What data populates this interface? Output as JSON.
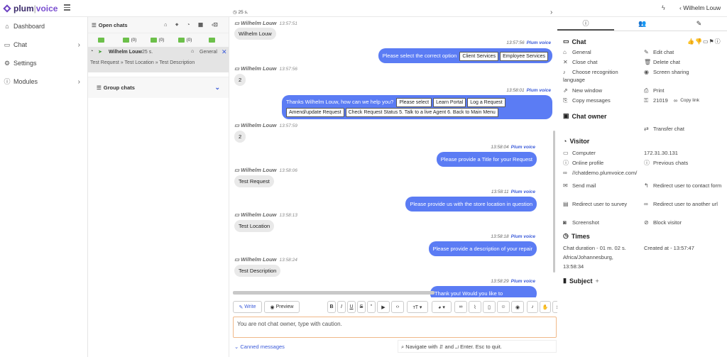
{
  "brand": {
    "name_left": "plum",
    "name_right": "voice"
  },
  "topbar": {
    "counter": "25 s.",
    "user": "Wilhelm Louw"
  },
  "sidebar": {
    "items": [
      {
        "label": "Dashboard",
        "icon": "home-icon"
      },
      {
        "label": "Chat",
        "icon": "chat-icon"
      },
      {
        "label": "Settings",
        "icon": "settings-icon"
      },
      {
        "label": "Modules",
        "icon": "info-icon"
      }
    ]
  },
  "chats": {
    "header": "Open chats",
    "filters": [
      "",
      "(0)",
      "(0)",
      "(0)",
      ""
    ],
    "active": {
      "name": "Wilhelm Louw",
      "time": "25 s.",
      "dept": "General",
      "path": "Test Request » Test Location » Test Description"
    },
    "group_header": "Group chats"
  },
  "conversation": {
    "visitor_name": "Wilhelm Louw",
    "operator_name": "Plum voice",
    "messages": [
      {
        "from": "visitor",
        "time": "13:57:51",
        "text": "Wilhelm Louw"
      },
      {
        "from": "operator",
        "time": "13:57:56",
        "text": "Please select the correct option",
        "buttons": [
          "Client Services",
          "Employee Services"
        ]
      },
      {
        "from": "visitor",
        "time": "13:57:56",
        "text": "2"
      },
      {
        "from": "operator",
        "time": "13:58:01",
        "text": "Thanks Wilhelm Louw, how can we help you?",
        "buttons": [
          "Please select",
          "Learn Portal",
          "Log a Request"
        ],
        "buttons2": [
          "Amend/update Request",
          "Check Request Status 5. Talk to a live Agent 6. Back to Main Menu"
        ]
      },
      {
        "from": "visitor",
        "time": "13:57:59",
        "text": "2"
      },
      {
        "from": "operator",
        "time": "13:58:04",
        "text": "Please provide a Title for your Request"
      },
      {
        "from": "visitor",
        "time": "13:58:06",
        "text": "Test Request"
      },
      {
        "from": "operator",
        "time": "13:58:11",
        "text": "Please provide us with the store location in question"
      },
      {
        "from": "visitor",
        "time": "13:58:13",
        "text": "Test Location"
      },
      {
        "from": "operator",
        "time": "13:58:18",
        "text": "Please provide a description of your repair"
      },
      {
        "from": "visitor",
        "time": "13:58:24",
        "text": "Test Description"
      },
      {
        "from": "operator",
        "time": "13:58:29",
        "text": "Thank you! Would you like to"
      }
    ]
  },
  "editor": {
    "write_label": "Write",
    "preview_label": "Preview",
    "format_buttons": [
      "B",
      "I",
      "U",
      "S",
      "\""
    ],
    "placeholder": "You are not chat owner, type with caution.",
    "canned_label": "Canned messages",
    "nav_hint": "Navigate with ⇵ and ↵ Enter. Esc to quit."
  },
  "right": {
    "chat_title": "Chat",
    "chat_actions_left": [
      "General",
      "Close chat",
      "Choose recognition language",
      "New window",
      "Copy messages"
    ],
    "chat_actions_right": [
      "Edit chat",
      "Delete chat",
      "Screen sharing",
      "Print"
    ],
    "chat_id": "21019",
    "copy_link": "Copy link",
    "owner_title": "Chat owner",
    "transfer": "Transfer chat",
    "visitor_title": "Visitor",
    "computer": "Computer",
    "ip": "172.31.30.131",
    "online_profile": "Online profile",
    "previous_chats": "Previous chats",
    "url": "//chatdemo.plumvoice.com/",
    "send_mail": "Send mail",
    "redirect_contact": "Redirect user to contact form",
    "redirect_survey": "Redirect user to survey",
    "redirect_url": "Redirect user to another url",
    "screenshot": "Screenshot",
    "block": "Block visitor",
    "times_title": "Times",
    "duration": "Chat duration - 01 m. 02 s.",
    "created": "Created at - 13:57:47",
    "tz": "Africa/Johannesburg,",
    "tz_time": "13:58:34",
    "subject_title": "Subject",
    "subject_add": "+"
  },
  "colors": {
    "accent": "#5b7cf4",
    "operator_name": "#3b5bd9",
    "filter_green": "#6cc04a"
  }
}
